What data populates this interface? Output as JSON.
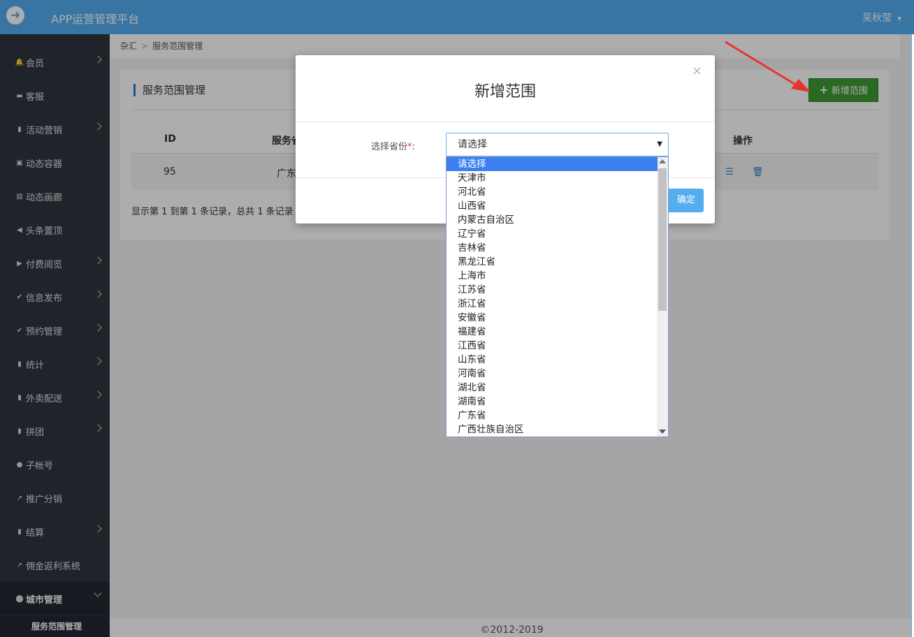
{
  "header": {
    "title": "APP运营管理平台",
    "user": "吴秋莹",
    "user_caret": "▾"
  },
  "sidebar": {
    "items": [
      {
        "label": "会员",
        "icon": "bell-icon",
        "glyph": "🔔",
        "arrow": true
      },
      {
        "label": "客服",
        "icon": "chat-icon",
        "glyph": "▬",
        "arrow": false
      },
      {
        "label": "活动营销",
        "icon": "bookmark-icon",
        "glyph": "▮",
        "arrow": true
      },
      {
        "label": "动态容器",
        "icon": "inbox-icon",
        "glyph": "▣",
        "arrow": false
      },
      {
        "label": "动态画廊",
        "icon": "picture-icon",
        "glyph": "▨",
        "arrow": false
      },
      {
        "label": "头条置顶",
        "icon": "volume-icon",
        "glyph": "◀",
        "arrow": false
      },
      {
        "label": "付费阅览",
        "icon": "play-icon",
        "glyph": "▶",
        "arrow": true
      },
      {
        "label": "信息发布",
        "icon": "check-icon",
        "glyph": "✔",
        "arrow": true
      },
      {
        "label": "预约管理",
        "icon": "check-icon",
        "glyph": "✔",
        "arrow": true
      },
      {
        "label": "统计",
        "icon": "bar-chart-icon",
        "glyph": "▮",
        "arrow": true
      },
      {
        "label": "外卖配送",
        "icon": "bar-chart-icon",
        "glyph": "▮",
        "arrow": true
      },
      {
        "label": "拼团",
        "icon": "bar-chart-icon",
        "glyph": "▮",
        "arrow": true
      },
      {
        "label": "子帐号",
        "icon": "user-icon",
        "glyph": "●",
        "arrow": false
      },
      {
        "label": "推广分销",
        "icon": "share-icon",
        "glyph": "↗",
        "arrow": false
      },
      {
        "label": "结算",
        "icon": "bar-chart-icon",
        "glyph": "▮",
        "arrow": true
      },
      {
        "label": "佣金返利系统",
        "icon": "share-icon",
        "glyph": "↗",
        "arrow": false
      },
      {
        "label": "城市管理",
        "icon": "map-marker-icon",
        "glyph": "⬤",
        "arrow": true,
        "active": true
      }
    ],
    "sub_item": "服务范围管理"
  },
  "breadcrumb": {
    "parent": "杂汇",
    "separator": ">",
    "current": "服务范围管理"
  },
  "panel": {
    "title": "服务范围管理",
    "add_button": "新增范围",
    "add_button_icon": "+",
    "columns": [
      "ID",
      "服务省",
      "操作"
    ],
    "row": {
      "id": "95",
      "province": "广东"
    },
    "summary": "显示第 1 到第 1 条记录，总共 1 条记录"
  },
  "modal": {
    "title": "新增范围",
    "close": "×",
    "field_label": "选择省份",
    "required_mark": "*",
    "colon": ":",
    "select_value": "请选择",
    "confirm": "确定",
    "options": [
      "请选择",
      "天津市",
      "河北省",
      "山西省",
      "内蒙古自治区",
      "辽宁省",
      "吉林省",
      "黑龙江省",
      "上海市",
      "江苏省",
      "浙江省",
      "安徽省",
      "福建省",
      "江西省",
      "山东省",
      "河南省",
      "湖北省",
      "湖南省",
      "广东省",
      "广西壮族自治区"
    ]
  },
  "footer": {
    "copyright": "©2012-2019"
  },
  "colors": {
    "topbar": "#55adf0",
    "sidebar": "#2f3540",
    "add_button": "#3e9b33",
    "selected_option": "#3c7ff0",
    "arrow": "#e8332b"
  }
}
